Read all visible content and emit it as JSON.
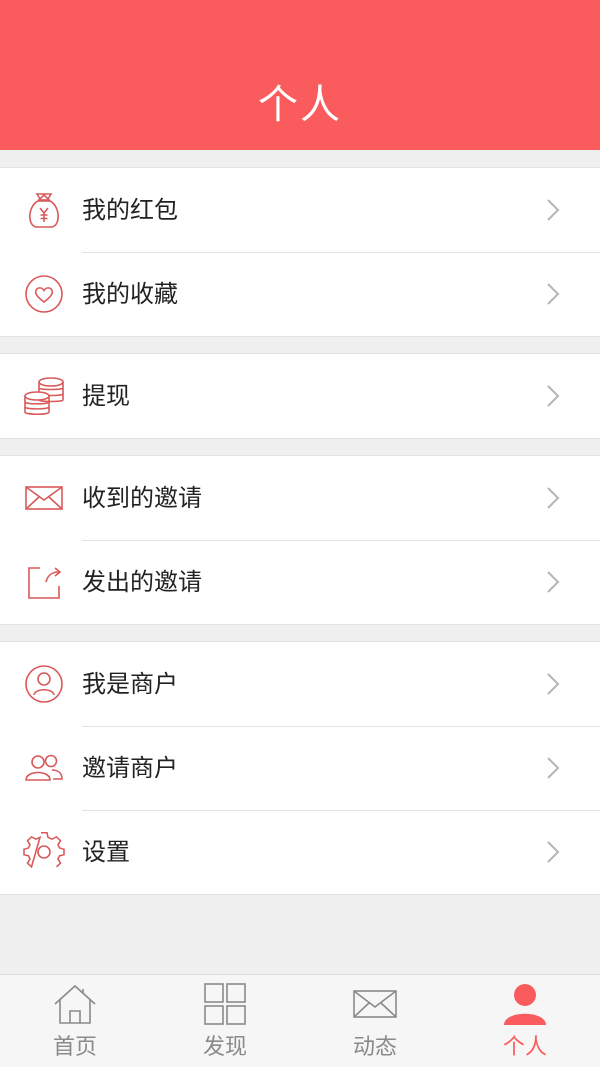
{
  "header": {
    "title": "个人"
  },
  "groups": [
    {
      "items": [
        {
          "label": "我的红包",
          "icon": "money-bag-icon"
        },
        {
          "label": "我的收藏",
          "icon": "heart-icon"
        }
      ]
    },
    {
      "items": [
        {
          "label": "提现",
          "icon": "coins-icon"
        }
      ]
    },
    {
      "items": [
        {
          "label": "收到的邀请",
          "icon": "envelope-icon"
        },
        {
          "label": "发出的邀请",
          "icon": "share-icon"
        }
      ]
    },
    {
      "items": [
        {
          "label": "我是商户",
          "icon": "user-circle-icon"
        },
        {
          "label": "邀请商户",
          "icon": "users-icon"
        },
        {
          "label": "设置",
          "icon": "gear-icon"
        }
      ]
    }
  ],
  "tabbar": {
    "tabs": [
      {
        "label": "首页",
        "icon": "home-icon"
      },
      {
        "label": "发现",
        "icon": "grid-icon"
      },
      {
        "label": "动态",
        "icon": "envelope-icon"
      },
      {
        "label": "个人",
        "icon": "person-icon",
        "active": true
      }
    ]
  },
  "colors": {
    "accent": "#fa5c5e",
    "icon_line": "#d9595b",
    "tab_inactive": "#8a8a8a"
  }
}
